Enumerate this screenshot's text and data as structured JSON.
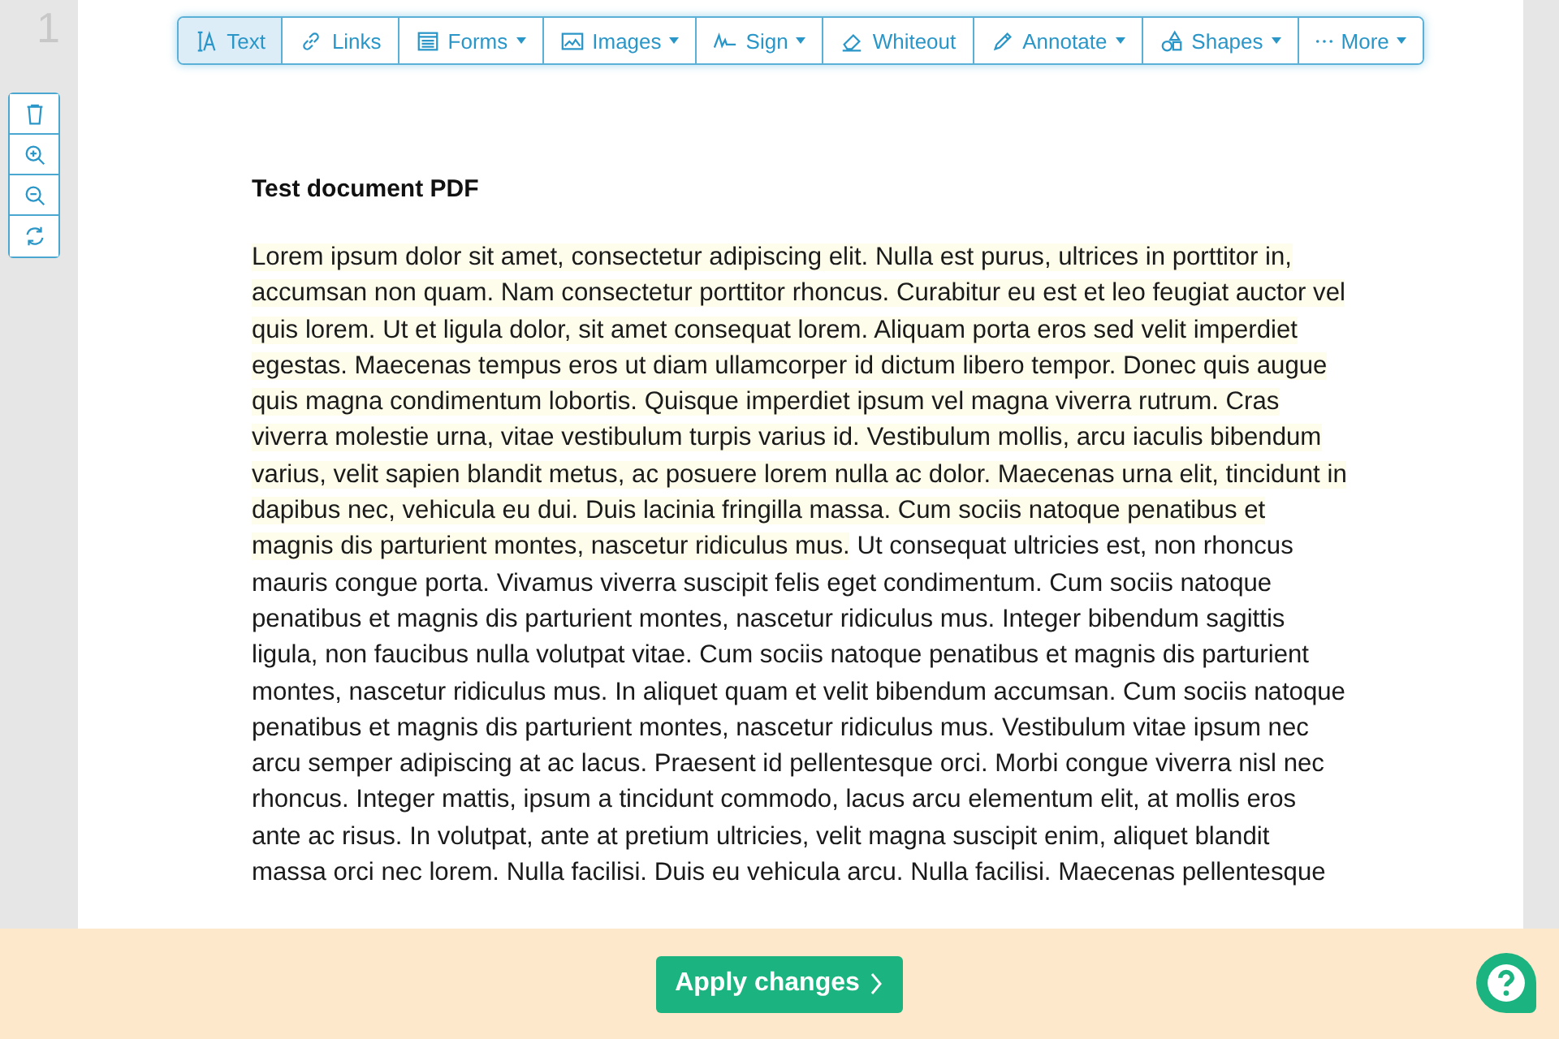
{
  "page_number": "1",
  "toolbar": [
    {
      "label": "Text",
      "dropdown": false,
      "selected": true
    },
    {
      "label": "Links",
      "dropdown": false,
      "selected": false
    },
    {
      "label": "Forms",
      "dropdown": true,
      "selected": false
    },
    {
      "label": "Images",
      "dropdown": true,
      "selected": false
    },
    {
      "label": "Sign",
      "dropdown": true,
      "selected": false
    },
    {
      "label": "Whiteout",
      "dropdown": false,
      "selected": false
    },
    {
      "label": "Annotate",
      "dropdown": true,
      "selected": false
    },
    {
      "label": "Shapes",
      "dropdown": true,
      "selected": false
    },
    {
      "label": "More",
      "dropdown": true,
      "selected": false
    }
  ],
  "document": {
    "title": "Test document PDF",
    "highlighted_text": "Lorem ipsum dolor sit amet, consectetur adipiscing elit. Nulla est purus, ultrices in porttitor in, accumsan non quam. Nam consectetur porttitor rhoncus. Curabitur eu est et leo feugiat auctor vel quis lorem. Ut et ligula dolor, sit amet consequat lorem. Aliquam porta eros sed velit imperdiet egestas. Maecenas tempus eros ut diam ullamcorper id dictum libero tempor. Donec quis augue quis magna condimentum lobortis. Quisque imperdiet ipsum vel magna viverra rutrum. Cras viverra molestie urna, vitae vestibulum turpis varius id. Vestibulum mollis, arcu iaculis bibendum varius, velit sapien blandit metus, ac posuere lorem nulla ac dolor. Maecenas urna elit, tincidunt in dapibus nec, vehicula eu dui. Duis lacinia fringilla massa. Cum sociis natoque penatibus et magnis dis parturient montes, nascetur ridiculus mus.",
    "text": "Ut consequat ultricies est, non rhoncus mauris congue porta. Vivamus viverra suscipit felis eget condimentum. Cum sociis natoque penatibus et magnis dis parturient montes, nascetur ridiculus mus. Integer bibendum sagittis ligula, non faucibus nulla volutpat vitae. Cum sociis natoque penatibus et magnis dis parturient montes, nascetur ridiculus mus. In aliquet quam et velit bibendum accumsan. Cum sociis natoque penatibus et magnis dis parturient montes, nascetur ridiculus mus. Vestibulum vitae ipsum nec arcu semper adipiscing at ac lacus. Praesent id pellentesque orci. Morbi congue viverra nisl nec rhoncus. Integer mattis, ipsum a tincidunt commodo, lacus arcu elementum elit, at mollis eros ante ac risus. In volutpat, ante at pretium ultricies, velit magna suscipit enim, aliquet blandit massa orci nec lorem. Nulla facilisi. Duis eu vehicula arcu. Nulla facilisi. Maecenas pellentesque"
  },
  "apply_button": {
    "label": "Apply changes"
  }
}
